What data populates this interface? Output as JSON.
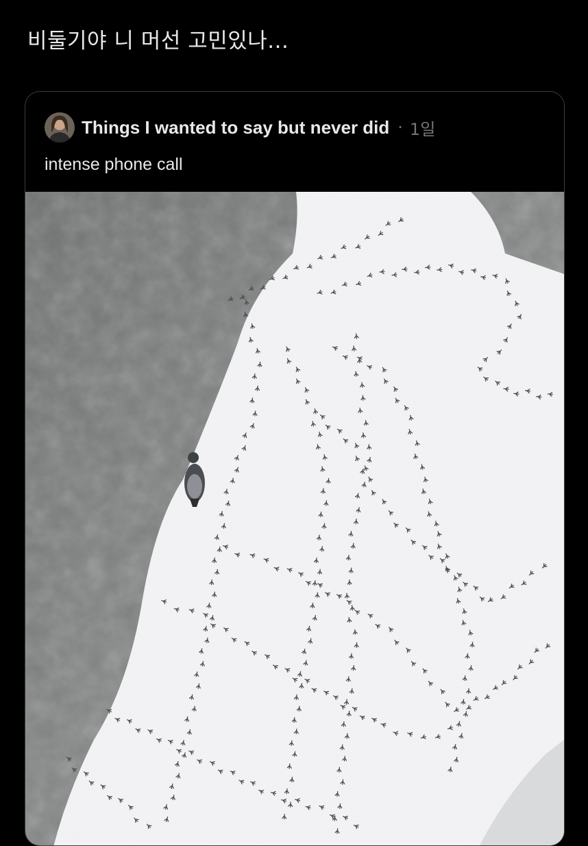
{
  "tweet": {
    "text": "비둘기야 니 머선 고민있나..."
  },
  "quoted_tweet": {
    "author_name": "Things I wanted to say but never did",
    "separator": "·",
    "timestamp": "1일",
    "text": "intense phone call",
    "media": {
      "subject": "pigeon walking on snow with many tracks",
      "icon": "pigeon"
    }
  },
  "colors": {
    "background": "#000000",
    "text": "#e7e9ea",
    "secondary_text": "#71767b",
    "card_border": "#3a3d41",
    "snow": "#f4f4f6",
    "concrete": "#7a7c7c"
  }
}
